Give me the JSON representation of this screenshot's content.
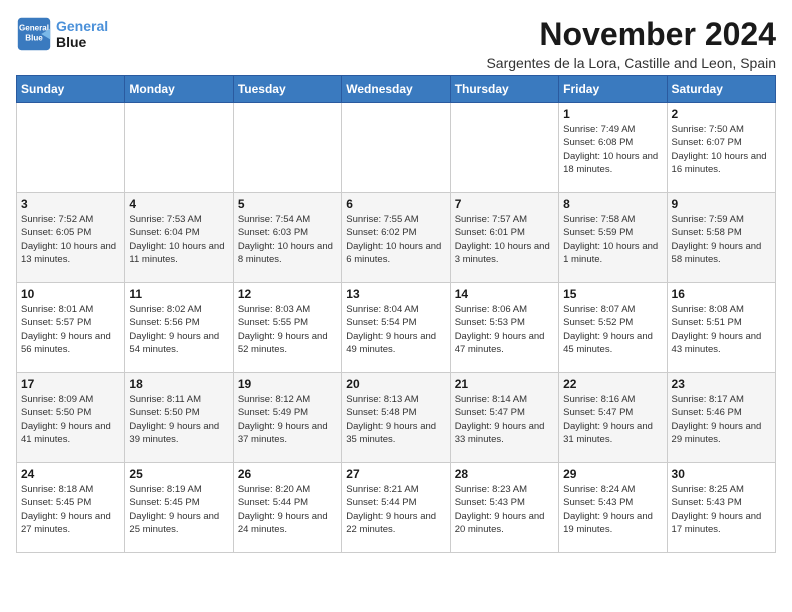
{
  "logo": {
    "line1": "General",
    "line2": "Blue"
  },
  "title": "November 2024",
  "location": "Sargentes de la Lora, Castille and Leon, Spain",
  "weekdays": [
    "Sunday",
    "Monday",
    "Tuesday",
    "Wednesday",
    "Thursday",
    "Friday",
    "Saturday"
  ],
  "weeks": [
    [
      {
        "day": "",
        "info": ""
      },
      {
        "day": "",
        "info": ""
      },
      {
        "day": "",
        "info": ""
      },
      {
        "day": "",
        "info": ""
      },
      {
        "day": "",
        "info": ""
      },
      {
        "day": "1",
        "info": "Sunrise: 7:49 AM\nSunset: 6:08 PM\nDaylight: 10 hours and 18 minutes."
      },
      {
        "day": "2",
        "info": "Sunrise: 7:50 AM\nSunset: 6:07 PM\nDaylight: 10 hours and 16 minutes."
      }
    ],
    [
      {
        "day": "3",
        "info": "Sunrise: 7:52 AM\nSunset: 6:05 PM\nDaylight: 10 hours and 13 minutes."
      },
      {
        "day": "4",
        "info": "Sunrise: 7:53 AM\nSunset: 6:04 PM\nDaylight: 10 hours and 11 minutes."
      },
      {
        "day": "5",
        "info": "Sunrise: 7:54 AM\nSunset: 6:03 PM\nDaylight: 10 hours and 8 minutes."
      },
      {
        "day": "6",
        "info": "Sunrise: 7:55 AM\nSunset: 6:02 PM\nDaylight: 10 hours and 6 minutes."
      },
      {
        "day": "7",
        "info": "Sunrise: 7:57 AM\nSunset: 6:01 PM\nDaylight: 10 hours and 3 minutes."
      },
      {
        "day": "8",
        "info": "Sunrise: 7:58 AM\nSunset: 5:59 PM\nDaylight: 10 hours and 1 minute."
      },
      {
        "day": "9",
        "info": "Sunrise: 7:59 AM\nSunset: 5:58 PM\nDaylight: 9 hours and 58 minutes."
      }
    ],
    [
      {
        "day": "10",
        "info": "Sunrise: 8:01 AM\nSunset: 5:57 PM\nDaylight: 9 hours and 56 minutes."
      },
      {
        "day": "11",
        "info": "Sunrise: 8:02 AM\nSunset: 5:56 PM\nDaylight: 9 hours and 54 minutes."
      },
      {
        "day": "12",
        "info": "Sunrise: 8:03 AM\nSunset: 5:55 PM\nDaylight: 9 hours and 52 minutes."
      },
      {
        "day": "13",
        "info": "Sunrise: 8:04 AM\nSunset: 5:54 PM\nDaylight: 9 hours and 49 minutes."
      },
      {
        "day": "14",
        "info": "Sunrise: 8:06 AM\nSunset: 5:53 PM\nDaylight: 9 hours and 47 minutes."
      },
      {
        "day": "15",
        "info": "Sunrise: 8:07 AM\nSunset: 5:52 PM\nDaylight: 9 hours and 45 minutes."
      },
      {
        "day": "16",
        "info": "Sunrise: 8:08 AM\nSunset: 5:51 PM\nDaylight: 9 hours and 43 minutes."
      }
    ],
    [
      {
        "day": "17",
        "info": "Sunrise: 8:09 AM\nSunset: 5:50 PM\nDaylight: 9 hours and 41 minutes."
      },
      {
        "day": "18",
        "info": "Sunrise: 8:11 AM\nSunset: 5:50 PM\nDaylight: 9 hours and 39 minutes."
      },
      {
        "day": "19",
        "info": "Sunrise: 8:12 AM\nSunset: 5:49 PM\nDaylight: 9 hours and 37 minutes."
      },
      {
        "day": "20",
        "info": "Sunrise: 8:13 AM\nSunset: 5:48 PM\nDaylight: 9 hours and 35 minutes."
      },
      {
        "day": "21",
        "info": "Sunrise: 8:14 AM\nSunset: 5:47 PM\nDaylight: 9 hours and 33 minutes."
      },
      {
        "day": "22",
        "info": "Sunrise: 8:16 AM\nSunset: 5:47 PM\nDaylight: 9 hours and 31 minutes."
      },
      {
        "day": "23",
        "info": "Sunrise: 8:17 AM\nSunset: 5:46 PM\nDaylight: 9 hours and 29 minutes."
      }
    ],
    [
      {
        "day": "24",
        "info": "Sunrise: 8:18 AM\nSunset: 5:45 PM\nDaylight: 9 hours and 27 minutes."
      },
      {
        "day": "25",
        "info": "Sunrise: 8:19 AM\nSunset: 5:45 PM\nDaylight: 9 hours and 25 minutes."
      },
      {
        "day": "26",
        "info": "Sunrise: 8:20 AM\nSunset: 5:44 PM\nDaylight: 9 hours and 24 minutes."
      },
      {
        "day": "27",
        "info": "Sunrise: 8:21 AM\nSunset: 5:44 PM\nDaylight: 9 hours and 22 minutes."
      },
      {
        "day": "28",
        "info": "Sunrise: 8:23 AM\nSunset: 5:43 PM\nDaylight: 9 hours and 20 minutes."
      },
      {
        "day": "29",
        "info": "Sunrise: 8:24 AM\nSunset: 5:43 PM\nDaylight: 9 hours and 19 minutes."
      },
      {
        "day": "30",
        "info": "Sunrise: 8:25 AM\nSunset: 5:43 PM\nDaylight: 9 hours and 17 minutes."
      }
    ]
  ]
}
